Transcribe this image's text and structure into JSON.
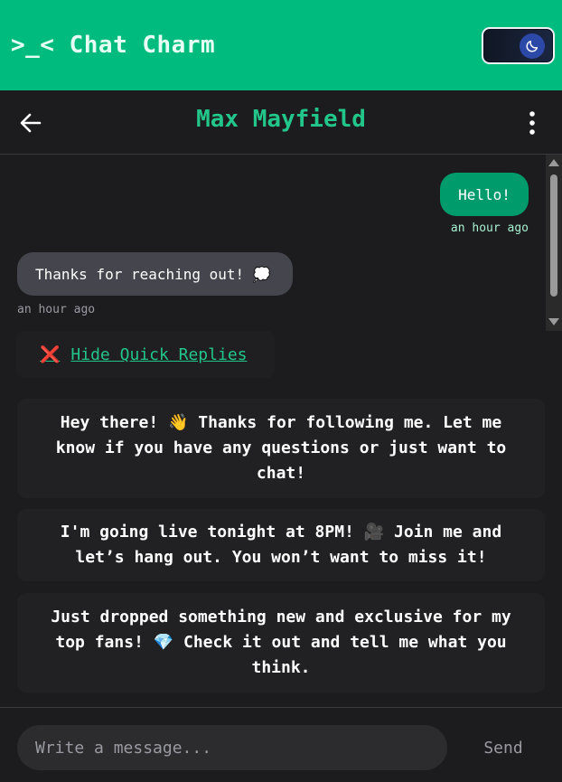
{
  "app": {
    "title": ">_< Chat Charm",
    "accent": "#00bb7e",
    "theme_icon": "moon-icon"
  },
  "chat": {
    "contact_name": "Max Mayfield",
    "back_icon": "arrow-left-icon",
    "menu_icon": "more-vertical-icon"
  },
  "messages": [
    {
      "direction": "outgoing",
      "text": "Hello!",
      "time": "an hour ago"
    },
    {
      "direction": "incoming",
      "text": "Thanks for reaching out! 💭",
      "time": "an hour ago"
    }
  ],
  "quick_replies": {
    "toggle_icon": "❌",
    "toggle_label": "Hide Quick Replies",
    "items": [
      "Hey there! 👋 Thanks for following me. Let me know if you have any questions or just want to chat!",
      "I'm going live tonight at 8PM! 🎥 Join me and let’s hang out. You won’t want to miss it!",
      "Just dropped something new and exclusive for my top fans! 💎 Check it out and tell me what you think."
    ]
  },
  "composer": {
    "placeholder": "Write a message...",
    "send_label": "Send"
  }
}
